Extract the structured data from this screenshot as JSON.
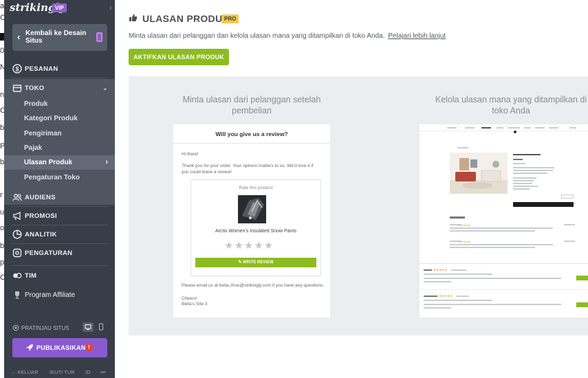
{
  "sidebar": {
    "brand": "strikingly",
    "vip_badge": "VIP",
    "back_button": "Kembali ke Desain Situs",
    "nav": [
      {
        "label": "PESANAN",
        "icon": "dollar-icon"
      },
      {
        "label": "TOKO",
        "icon": "store-icon"
      },
      {
        "label": "AUDIENS",
        "icon": "audience-icon"
      },
      {
        "label": "PROMOSI",
        "icon": "megaphone-icon"
      },
      {
        "label": "ANALITIK",
        "icon": "analytics-icon"
      },
      {
        "label": "PENGATURAN",
        "icon": "gear-icon"
      },
      {
        "label": "TIM",
        "icon": "team-icon"
      },
      {
        "label": "Program Affiliate",
        "icon": "trophy-icon"
      }
    ],
    "toko_items": [
      "Produk",
      "Kategori Produk",
      "Pengiriman",
      "Pajak",
      "Ulasan Produk",
      "Pengaturan Toko"
    ],
    "selected_item": "Ulasan Produk",
    "preview_label": "PRATINJAU SITUS",
    "publish_label": "PUBLIKASIKAN",
    "publish_alert": "!",
    "footer": {
      "logout": "KELUAR",
      "tour": "IKUTI TUR",
      "lang": "ID",
      "more": "•••"
    }
  },
  "main": {
    "title": "ULASAN PRODUK",
    "pro_badge": "PRO",
    "description": "Minta ulasan dari pelanggan dan kelola ulasan mana yang ditampilkan di toko Anda.",
    "learn_more": "Pelajari lebih lanjut",
    "activate_button": "AKTIFKAN ULASAN PRODUK",
    "left_caption": "Minta ulasan dari pelanggan setelah pembelian",
    "right_caption": "Kelola ulasan mana yang ditampilkan di toko Anda"
  },
  "email": {
    "header": "Will you give us a review?",
    "greeting": "Hi there!",
    "body": "Thank you for your order. Your opinion matters to us. We'd love it if you could leave a review!",
    "rate_label": "Rate this product",
    "product_name": "Arctix Women's Insulated Snow Pants",
    "stars": "★★★★★",
    "write_review": "✎ WRITE REVIEW",
    "contact": "Please email us at bella.zhou@strikingly.com if you have any questions.",
    "sign_off": "Cheers!",
    "signature": "Bella's Site 3"
  },
  "colors": {
    "sidebar": "#383e47",
    "accent_green": "#8cbc1f",
    "publish_purple": "#8a5ad0",
    "pro_yellow": "#f5c94b"
  }
}
